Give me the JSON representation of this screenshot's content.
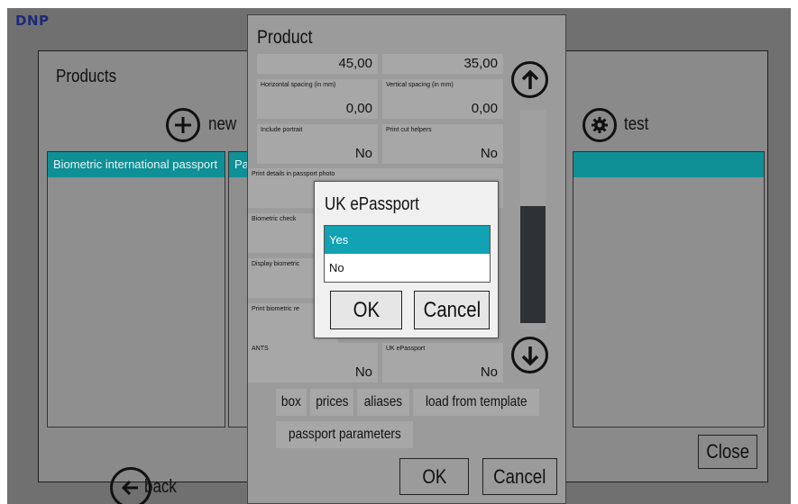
{
  "app": {
    "logo": "DNP"
  },
  "products": {
    "title": "Products",
    "new_label": "new",
    "test_label": "test",
    "list_header_left": "Biometric international passport",
    "list_header_mid": "Pa",
    "close_label": "Close",
    "back_label": "back"
  },
  "product_dialog": {
    "title": "Product",
    "width_value": "45,00",
    "height_value": "35,00",
    "h_spacing_label": "Horizontal spacing (in mm)",
    "h_spacing_value": "0,00",
    "v_spacing_label": "Vertical spacing (in mm)",
    "v_spacing_value": "0,00",
    "include_portrait_label": "Include portrait",
    "include_portrait_value": "No",
    "print_cut_label": "Print cut helpers",
    "print_cut_value": "No",
    "print_details_label": "Print details in passport photo",
    "biometric_check_label": "Biometric check",
    "display_biometric_label": "Display biometric",
    "print_biometric_label": "Print biometric re",
    "ants_label": "ANTS",
    "ants_value": "No",
    "uk_label": "UK ePassport",
    "uk_value": "No",
    "chips": [
      "box",
      "prices",
      "aliases",
      "load from template"
    ],
    "passport_params_label": "passport parameters",
    "ok_label": "OK",
    "cancel_label": "Cancel",
    "scroll_position": 0.47
  },
  "picker": {
    "title": "UK ePassport",
    "options": [
      "Yes",
      "No"
    ],
    "selected": "Yes",
    "ok_label": "OK",
    "cancel_label": "Cancel"
  },
  "colors": {
    "accent": "#11a2b3",
    "header_teal": "#0f8f96",
    "logo_blue": "#1e2a78"
  }
}
